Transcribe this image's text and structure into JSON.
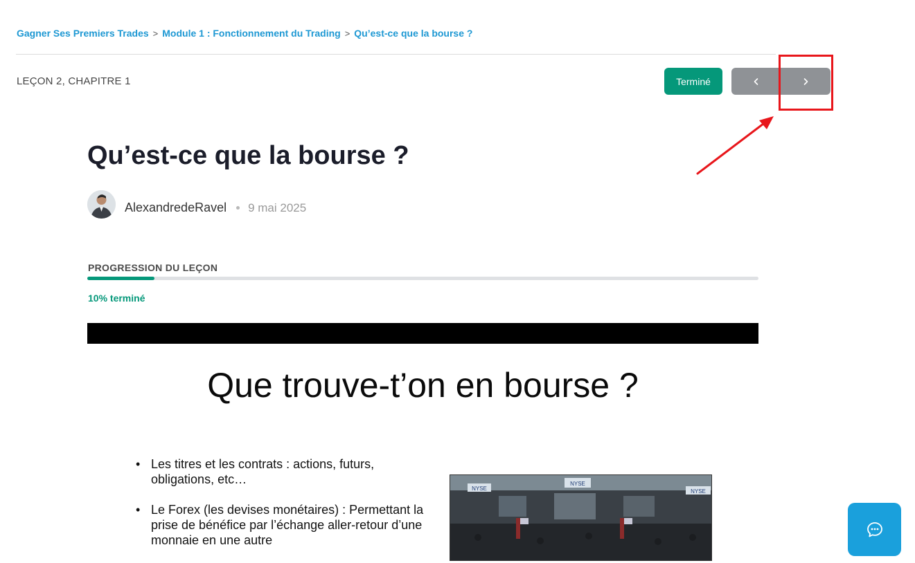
{
  "breadcrumb": {
    "items": [
      "Gagner Ses Premiers Trades",
      "Module 1 : Fonctionnement du Trading",
      "Qu’est-ce que la bourse ?"
    ],
    "separator": ">"
  },
  "lesson": {
    "label": "LEÇON 2, CHAPITRE 1"
  },
  "toolbar": {
    "done_label": "Terminé",
    "prev_icon": "chevron-left-icon",
    "next_icon": "chevron-right-icon"
  },
  "page": {
    "title": "Qu’est-ce que la bourse ?"
  },
  "author": {
    "name": "AlexandredeRavel",
    "date": "9 mai 2025"
  },
  "progress": {
    "title": "PROGRESSION DU LEÇON",
    "percent": 10,
    "text": "10% terminé"
  },
  "slide": {
    "title": "Que trouve-t’on en bourse ?",
    "bullets": [
      "Les titres et les contrats : actions, futurs, obligations, etc…",
      "Le Forex (les devises monétaires) : Permettant la prise de bénéfice par l’échange aller-retour d’une monnaie en une autre"
    ],
    "photo_signs": [
      "NYSE",
      "NYSE",
      "NYSE"
    ]
  },
  "colors": {
    "accent": "#05987a",
    "link": "#1e98d3",
    "nav": "#8f9296",
    "chat": "#1aa0dc",
    "highlight": "#e8161b"
  },
  "chat": {
    "icon": "chat-bubble-icon"
  }
}
